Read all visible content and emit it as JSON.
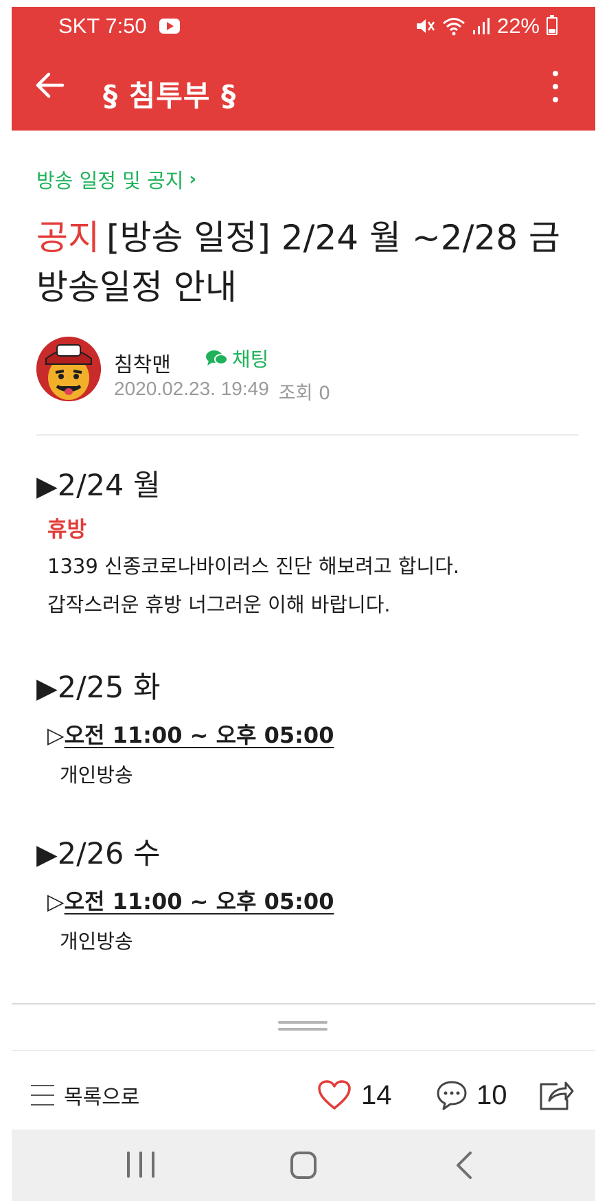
{
  "status_bar": {
    "carrier_time": "SKT 7:50",
    "battery": "22%",
    "icons": [
      "youtube-icon",
      "mute-icon",
      "wifi-icon",
      "signal-icon",
      "battery-icon"
    ]
  },
  "app_bar": {
    "title": "§ 침투부 §",
    "background_color": "#e23d3a"
  },
  "article": {
    "board": "방송 일정 및 공지",
    "tag": "공지",
    "title": "[방송 일정] 2/24 월 ~2/28 금 방송일정 안내",
    "author": {
      "name": "침착맨",
      "chat_label": "채팅"
    },
    "date": "2020.02.23. 19:49",
    "views_label": "조회 0",
    "body": {
      "day1": {
        "heading": "2/24 월",
        "off_label": "휴방",
        "lines": [
          "1339 신종코로나바이러스 진단 해보려고 합니다.",
          "갑작스러운 휴방 너그러운 이해 바랍니다."
        ]
      },
      "day2": {
        "heading": "2/25 화",
        "time": "오전 11:00 ~ 오후 05:00",
        "program": "개인방송"
      },
      "day3": {
        "heading": "2/26 수",
        "time": "오전 11:00 ~ 오후 05:00",
        "program": "개인방송"
      }
    }
  },
  "bottom_bar": {
    "list_label": "목록으로",
    "like_count": "14",
    "comment_count": "10"
  },
  "accent_colors": {
    "red": "#e23d3a",
    "green": "#1fb25a",
    "meta_gray": "#9a9a9a"
  }
}
